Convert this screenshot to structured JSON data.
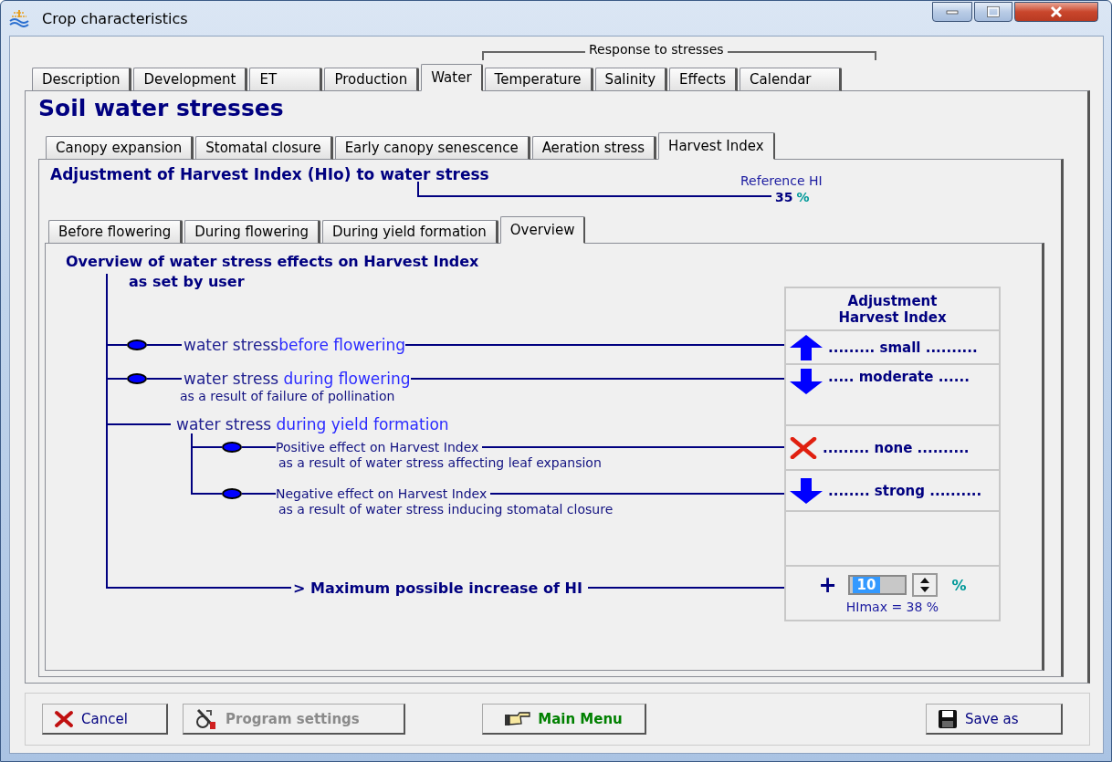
{
  "window": {
    "title": "Crop characteristics"
  },
  "group_label": "Response to stresses",
  "tabs": [
    {
      "label": "Description",
      "selected": false
    },
    {
      "label": "Development",
      "selected": false
    },
    {
      "label": "ET",
      "selected": false
    },
    {
      "label": "Production",
      "selected": false
    },
    {
      "label": "Water",
      "selected": true
    },
    {
      "label": "Temperature",
      "selected": false
    },
    {
      "label": "Salinity",
      "selected": false
    },
    {
      "label": "Effects",
      "selected": false
    },
    {
      "label": "Calendar",
      "selected": false
    }
  ],
  "section_title": "Soil water stresses",
  "stress_tabs": [
    {
      "label": "Canopy expansion",
      "selected": false
    },
    {
      "label": "Stomatal closure",
      "selected": false
    },
    {
      "label": "Early canopy senescence",
      "selected": false
    },
    {
      "label": "Aeration stress",
      "selected": false
    },
    {
      "label": "Harvest Index",
      "selected": true
    }
  ],
  "heading": "Adjustment of Harvest Index (HIo) to water stress",
  "reference_hi": {
    "label": "Reference HI",
    "value": "35",
    "unit": "%"
  },
  "period_tabs": [
    {
      "label": "Before flowering",
      "selected": false
    },
    {
      "label": "During flowering",
      "selected": false
    },
    {
      "label": "During yield formation",
      "selected": false
    },
    {
      "label": "Overview",
      "selected": true
    }
  ],
  "overview": {
    "title": "Overview of water stress effects on Harvest Index",
    "subtitle": "as set by user",
    "table_header": [
      "Adjustment",
      "Harvest Index"
    ],
    "items": [
      {
        "kind": "stage",
        "prefix": "water stress",
        "stage": "before flowering",
        "effect": {
          "kind": "increase",
          "label": "......... small .........."
        }
      },
      {
        "kind": "stage",
        "prefix": "water stress ",
        "stage": "during flowering",
        "note": "as a result of failure of pollination",
        "effect": {
          "kind": "decrease",
          "label": "..... moderate ......"
        }
      },
      {
        "kind": "group",
        "prefix": "water stress ",
        "stage": "during yield formation",
        "children": [
          {
            "label": "Positive effect on Harvest Index",
            "note": "as a result of water stress affecting leaf expansion",
            "effect": {
              "kind": "none",
              "label": "......... none .........."
            }
          },
          {
            "label": "Negative effect on Harvest Index",
            "note": "as a result of water stress inducing stomatal closure",
            "effect": {
              "kind": "decrease",
              "label": "........ strong .........."
            }
          }
        ]
      }
    ],
    "max_increase": {
      "label": "> Maximum possible increase of HI",
      "sign": "+",
      "value": "10",
      "unit": "%",
      "himax": "HImax = 38 %"
    }
  },
  "buttons": [
    {
      "kind": "cancel",
      "label": "Cancel",
      "disabled": false
    },
    {
      "kind": "settings",
      "label": "Program settings",
      "disabled": true
    },
    {
      "kind": "menu",
      "label": "Main Menu",
      "disabled": false
    },
    {
      "kind": "save",
      "label": "Save as",
      "disabled": false
    }
  ]
}
